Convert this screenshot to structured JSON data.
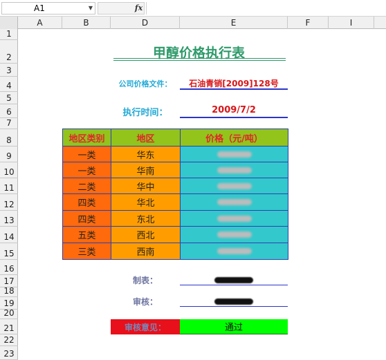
{
  "formula_bar": {
    "name_box": "A1",
    "fx_label": "fx",
    "formula": ""
  },
  "columns": [
    "A",
    "B",
    "D",
    "E",
    "F",
    "I"
  ],
  "rows": [
    "1",
    "2",
    "3",
    "4",
    "5",
    "6",
    "7",
    "8",
    "9",
    "10",
    "11",
    "12",
    "13",
    "14",
    "15",
    "16",
    "17",
    "18",
    "19",
    "20",
    "21",
    "22",
    "23"
  ],
  "sheet": {
    "title": "甲醇价格执行表",
    "doc_label": "公司价格文件：",
    "doc_value": "石油青销[2009]128号",
    "time_label": "执行时间：",
    "time_value": "2009/7/2",
    "table": {
      "headers": [
        "地区类别",
        "地区",
        "价格（元/吨）"
      ],
      "rows": [
        {
          "category": "一类",
          "region": "华东"
        },
        {
          "category": "一类",
          "region": "华南"
        },
        {
          "category": "二类",
          "region": "华中"
        },
        {
          "category": "四类",
          "region": "华北"
        },
        {
          "category": "四类",
          "region": "东北"
        },
        {
          "category": "五类",
          "region": "西北"
        },
        {
          "category": "三类",
          "region": "西南"
        }
      ]
    },
    "maker_label": "制表：",
    "reviewer_label": "审核：",
    "opinion_label": "审核意见：",
    "opinion_value": "通过"
  },
  "colors": {
    "title": "#2e9a6a",
    "label": "#21a9d6",
    "value": "#d8161a",
    "header_bg": "#92c41c",
    "col_b": "#ff6a0c",
    "col_d": "#ff9d00",
    "col_e": "#33c8cc",
    "opinion_label_bg": "#e8101a",
    "opinion_value_bg": "#00ff00"
  }
}
